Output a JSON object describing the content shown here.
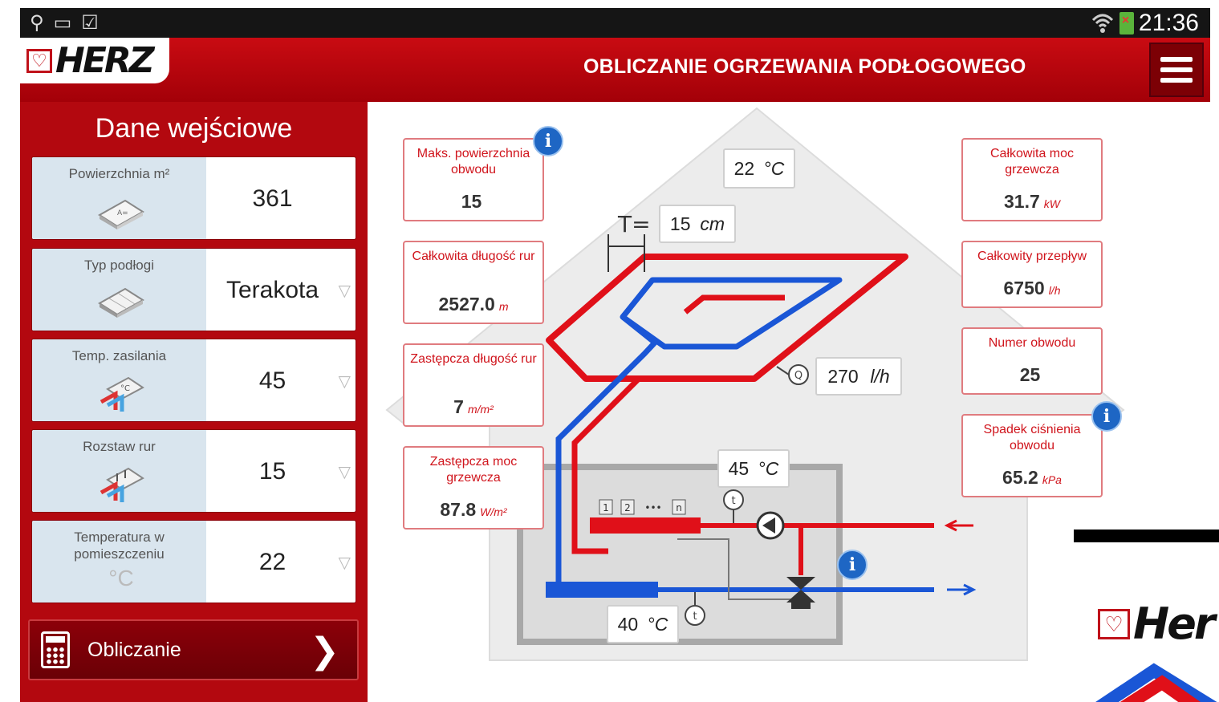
{
  "status_bar": {
    "time": "21:36",
    "icons": [
      "usb-icon",
      "screen-icon",
      "clipboard-icon",
      "wifi-icon",
      "battery-icon"
    ]
  },
  "header": {
    "logo_text": "HERZ",
    "title": "OBLICZANIE OGRZEWANIA PODŁOGOWEGO",
    "menu_icon": "hamburger-menu-icon"
  },
  "input_panel": {
    "title": "Dane wejściowe",
    "items": [
      {
        "label": "Powierzchnia m²",
        "value": "361",
        "icon": "area-tile-icon",
        "dropdown": false
      },
      {
        "label": "Typ podłogi",
        "value": "Terakota",
        "icon": "floor-type-icon",
        "dropdown": true
      },
      {
        "label": "Temp. zasilania",
        "value": "45",
        "icon": "supply-temp-icon",
        "dropdown": true
      },
      {
        "label": "Rozstaw rur",
        "value": "15",
        "icon": "pipe-spacing-icon",
        "dropdown": true
      },
      {
        "label": "Temperatura w pomieszczeniu",
        "value": "22",
        "icon": "room-temp-icon",
        "dropdown": true
      }
    ],
    "calculate_button": "Obliczanie"
  },
  "results_left": [
    {
      "label": "Maks. powierzchnia obwodu",
      "value": "15",
      "unit": ""
    },
    {
      "label": "Całkowita długość rur",
      "value": "2527.0",
      "unit": "m"
    },
    {
      "label": "Zastępcza długość rur",
      "value": "7",
      "unit": "m/m²"
    },
    {
      "label": "Zastępcza moc grzewcza",
      "value": "87.8",
      "unit": "W/m²"
    }
  ],
  "results_right": [
    {
      "label": "Całkowita moc grzewcza",
      "value": "31.7",
      "unit": "kW"
    },
    {
      "label": "Całkowity przepływ",
      "value": "6750",
      "unit": "l/h"
    },
    {
      "label": "Numer obwodu",
      "value": "25",
      "unit": ""
    },
    {
      "label": "Spadek ciśnienia obwodu",
      "value": "65.2",
      "unit": "kPa"
    }
  ],
  "diagram": {
    "room_temp": {
      "value": "22",
      "unit": "°C"
    },
    "spacing_symbol": "T=",
    "spacing": {
      "value": "15",
      "unit": "cm"
    },
    "flow": {
      "value": "270",
      "unit": "l/h"
    },
    "supply_temp": {
      "value": "45",
      "unit": "°C"
    },
    "return_temp": {
      "value": "40",
      "unit": "°C"
    },
    "manifold_labels": [
      "1",
      "2",
      "•••",
      "n"
    ],
    "flow_symbol": "Q",
    "temp_symbol": "t",
    "colors": {
      "supply": "#e01019",
      "return": "#1a56d6",
      "house": "#ececec"
    }
  },
  "corner_logo_text": "Her"
}
